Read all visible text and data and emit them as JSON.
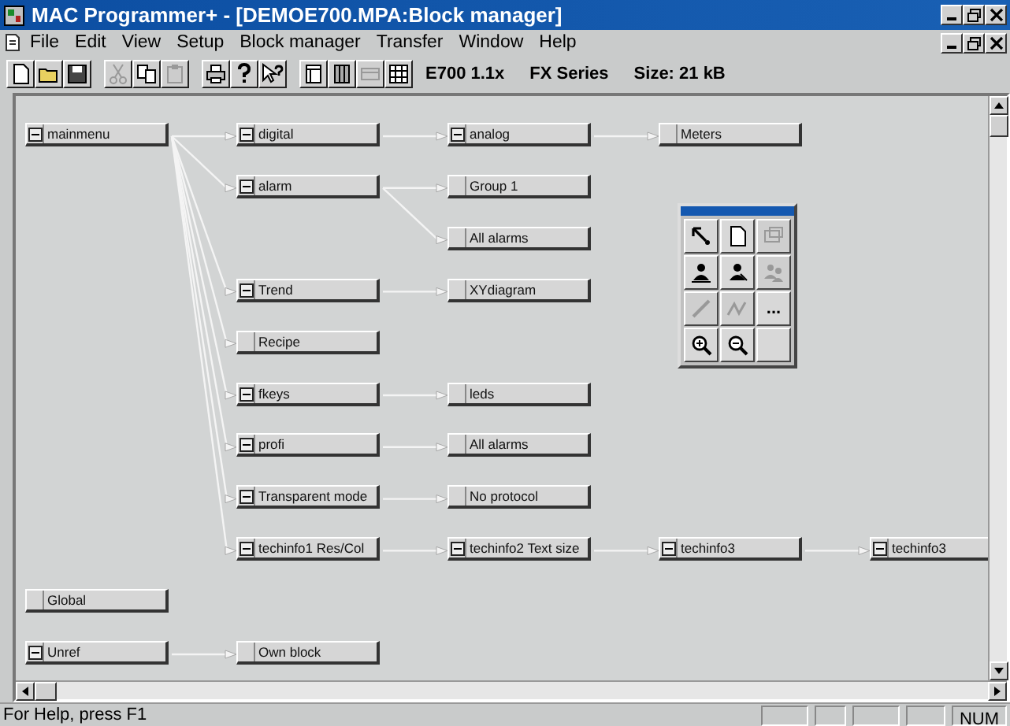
{
  "window": {
    "title": "MAC Programmer+ - [DEMOE700.MPA:Block manager]"
  },
  "menu": [
    "File",
    "Edit",
    "View",
    "Setup",
    "Block manager",
    "Transfer",
    "Window",
    "Help"
  ],
  "toolbar": {
    "groups": [
      [
        {
          "kind": "new",
          "disabled": false
        },
        {
          "kind": "open",
          "disabled": false
        },
        {
          "kind": "save",
          "disabled": false
        }
      ],
      [
        {
          "kind": "cut",
          "disabled": true
        },
        {
          "kind": "copy",
          "disabled": false
        },
        {
          "kind": "paste",
          "disabled": true
        }
      ],
      [
        {
          "kind": "print",
          "disabled": false
        },
        {
          "kind": "help",
          "disabled": false
        },
        {
          "kind": "context-help",
          "disabled": false
        }
      ],
      [
        {
          "kind": "window",
          "disabled": false
        },
        {
          "kind": "columns",
          "disabled": false
        },
        {
          "kind": "panel",
          "disabled": true
        },
        {
          "kind": "grid",
          "disabled": false
        }
      ]
    ],
    "info": [
      "E700 1.1x",
      "FX Series",
      "Size: 21 kB"
    ]
  },
  "blocks": [
    {
      "label": "mainmenu",
      "expanded": true,
      "children": [
        {
          "label": "digital",
          "expanded": true,
          "children": [
            {
              "label": "analog",
              "expanded": true,
              "children": [
                {
                  "label": "Meters",
                  "expanded": false
                }
              ]
            }
          ]
        },
        {
          "label": "alarm",
          "expanded": true,
          "children": [
            {
              "label": "Group 1",
              "expanded": false
            },
            {
              "label": "All alarms",
              "expanded": false
            }
          ]
        },
        {
          "label": "Trend",
          "expanded": true,
          "children": [
            {
              "label": "XYdiagram",
              "expanded": false
            }
          ]
        },
        {
          "label": "Recipe",
          "expanded": false
        },
        {
          "label": "fkeys",
          "expanded": true,
          "children": [
            {
              "label": "leds",
              "expanded": false
            }
          ]
        },
        {
          "label": "profi",
          "expanded": true,
          "children": [
            {
              "label": "All alarms",
              "expanded": false
            }
          ]
        },
        {
          "label": "Transparent mode",
          "expanded": true,
          "children": [
            {
              "label": "No protocol",
              "expanded": false
            }
          ]
        },
        {
          "label": "techinfo1 Res/Col",
          "expanded": true,
          "children": [
            {
              "label": "techinfo2 Text size",
              "expanded": true,
              "children": [
                {
                  "label": "techinfo3",
                  "expanded": true,
                  "children": [
                    {
                      "label": "techinfo3",
                      "expanded": true
                    }
                  ]
                }
              ]
            }
          ]
        }
      ]
    },
    {
      "label": "Global",
      "expanded": false
    },
    {
      "label": "Unref",
      "expanded": true,
      "children": [
        {
          "label": "Own block",
          "expanded": false
        }
      ]
    }
  ],
  "palette": {
    "tools": [
      {
        "kind": "pointer",
        "disabled": false
      },
      {
        "kind": "page",
        "disabled": false
      },
      {
        "kind": "frame",
        "disabled": true
      },
      {
        "kind": "person-add",
        "disabled": false
      },
      {
        "kind": "person-remove",
        "disabled": false
      },
      {
        "kind": "people",
        "disabled": true
      },
      {
        "kind": "link",
        "disabled": true
      },
      {
        "kind": "chain",
        "disabled": true
      },
      {
        "kind": "more",
        "disabled": false,
        "label": "..."
      },
      {
        "kind": "zoom-in",
        "disabled": false
      },
      {
        "kind": "zoom-out",
        "disabled": false
      },
      {
        "kind": "empty"
      }
    ]
  },
  "status_bar": {
    "text": "For Help, press F1",
    "indicator": "NUM"
  }
}
